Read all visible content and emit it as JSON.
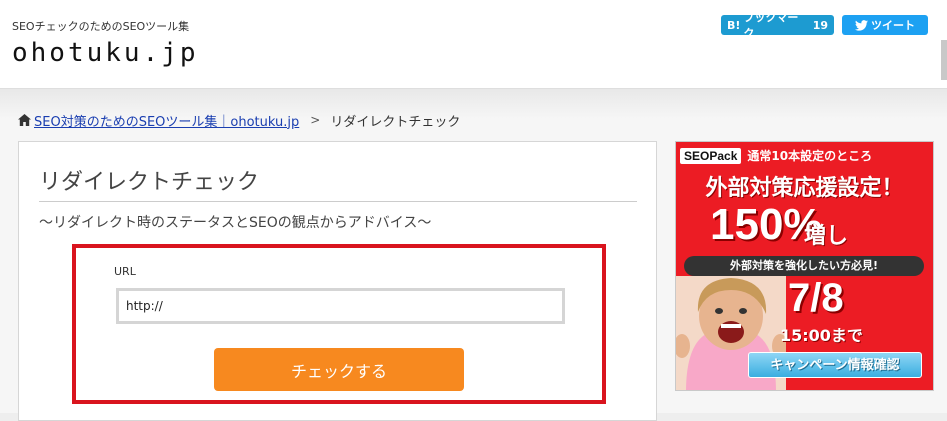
{
  "header": {
    "tagline": "SEOチェックのためのSEOツール集",
    "logo": "ohotuku.jp",
    "hatena": {
      "icon_text": "B!",
      "label": "ブックマーク",
      "count": "19"
    },
    "tweet": {
      "label": "ツイート"
    }
  },
  "breadcrumb": {
    "home_link": "SEO対策のためのSEOツール集｜ohotuku.jp",
    "separator": ">",
    "current": "リダイレクトチェック"
  },
  "main": {
    "title": "リダイレクトチェック",
    "subtitle": "～リダイレクト時のステータスとSEOの観点からアドバイス～",
    "form": {
      "url_label": "URL",
      "url_value": "http://",
      "submit_label": "チェックする"
    }
  },
  "ad": {
    "brand": "SEOPack",
    "line1": "通常10本設定のところ",
    "line2": "外部対策応援設定！",
    "percent": "150%",
    "percent_suffix": "増し",
    "banner": "外部対策を強化したい方必見!",
    "date": "7/8",
    "time": "15:00まで",
    "cta": "キャンペーン情報確認"
  },
  "colors": {
    "highlight_border": "#d9141e",
    "button_orange": "#f7891f",
    "hatena_blue": "#1d9bd1",
    "twitter_blue": "#1da1f2",
    "ad_red": "#ec1c24"
  }
}
